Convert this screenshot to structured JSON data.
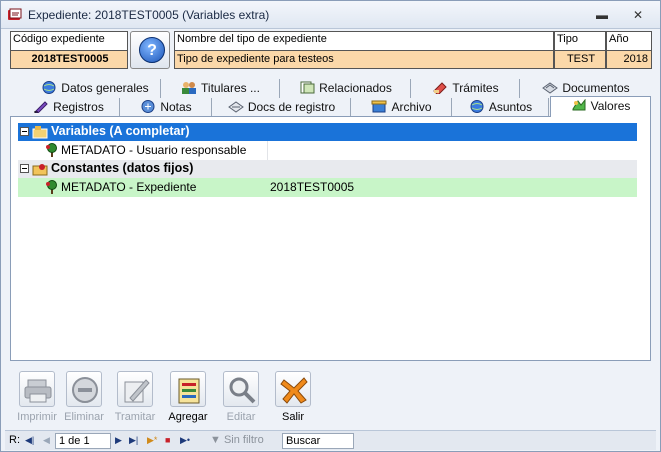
{
  "window": {
    "title": "Expediente: 2018TEST0005 (Variables extra)"
  },
  "header": {
    "codigo_label": "Código expediente",
    "codigo_value": "2018TEST0005",
    "nombre_label": "Nombre del tipo de expediente",
    "nombre_value": "Tipo de expediente para testeos",
    "tipo_label": "Tipo",
    "tipo_value": "TEST",
    "anio_label": "Año",
    "anio_value": "2018"
  },
  "tabs_row1": [
    {
      "label": "Datos generales",
      "icon": "globe-icon"
    },
    {
      "label": "Titulares ...",
      "icon": "users-icon"
    },
    {
      "label": "Relacionados",
      "icon": "related-docs-icon"
    },
    {
      "label": "Trámites",
      "icon": "tramites-icon"
    },
    {
      "label": "Documentos",
      "icon": "documents-icon"
    }
  ],
  "tabs_row2": [
    {
      "label": "Registros",
      "icon": "pen-icon"
    },
    {
      "label": "Notas",
      "icon": "notes-icon"
    },
    {
      "label": "Docs de registro",
      "icon": "register-docs-icon"
    },
    {
      "label": "Archivo",
      "icon": "archive-icon"
    },
    {
      "label": "Asuntos",
      "icon": "globe-icon"
    },
    {
      "label": "Valores",
      "icon": "values-icon",
      "active": true
    }
  ],
  "tree": {
    "group1": {
      "label": "Variables (A completar)"
    },
    "item1": {
      "label": "METADATO - Usuario responsable",
      "value": ""
    },
    "group2": {
      "label": "Constantes (datos fijos)"
    },
    "item2": {
      "label": "METADATO - Expediente",
      "value": "2018TEST0005"
    }
  },
  "toolbar": [
    {
      "label": "Imprimir",
      "enabled": false,
      "icon": "printer-icon"
    },
    {
      "label": "Eliminar",
      "enabled": false,
      "icon": "delete-icon"
    },
    {
      "label": "Tramitar",
      "enabled": false,
      "icon": "process-icon"
    },
    {
      "label": "Agregar",
      "enabled": true,
      "icon": "add-icon"
    },
    {
      "label": "Editar",
      "enabled": false,
      "icon": "edit-icon"
    },
    {
      "label": "Salir",
      "enabled": true,
      "icon": "exit-icon"
    }
  ],
  "statusbar": {
    "record_prefix": "R:",
    "page": "1 de 1",
    "filter": "Sin filtro",
    "search_placeholder": "Buscar"
  }
}
